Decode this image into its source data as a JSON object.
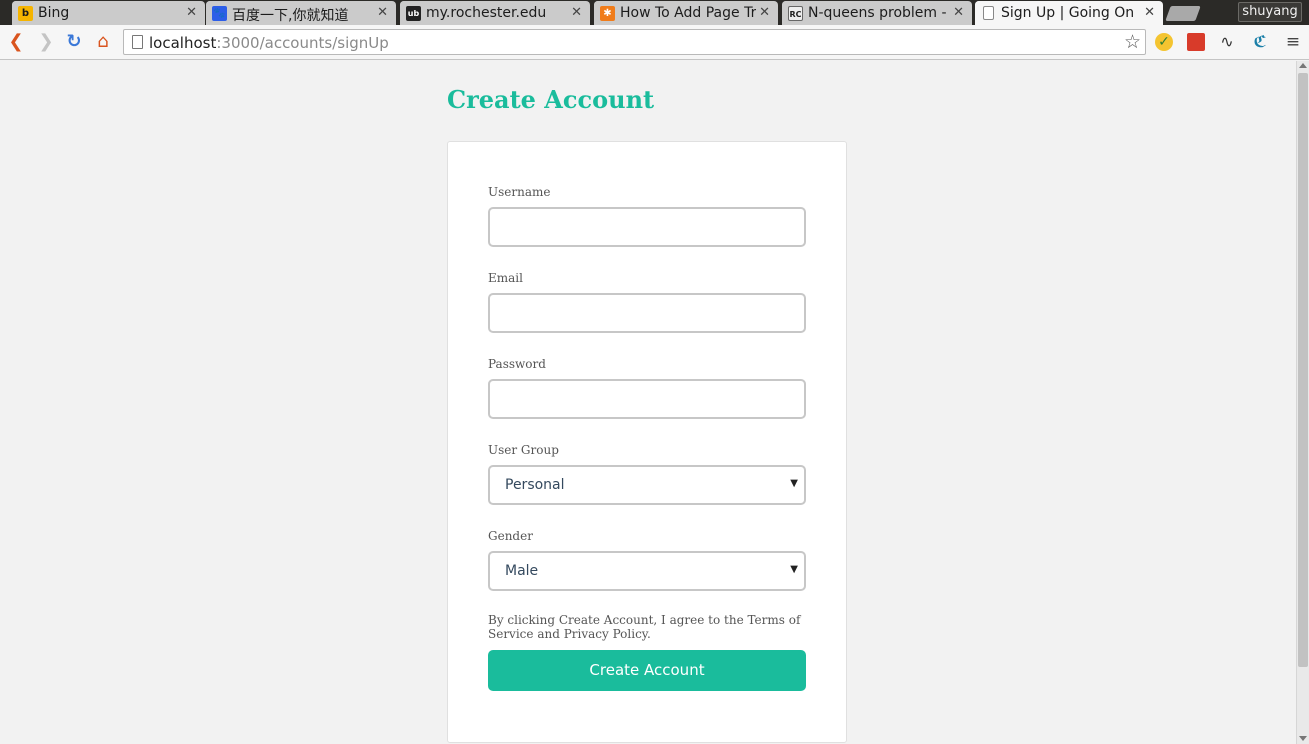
{
  "browser": {
    "tabs": [
      {
        "title": "Bing",
        "favicon": "bing-icon",
        "active": false
      },
      {
        "title": "百度一下,你就知道",
        "favicon": "baidu-paw-icon",
        "active": false
      },
      {
        "title": "my.rochester.edu",
        "favicon": "rochester-icon",
        "active": false
      },
      {
        "title": "How To Add Page Tr",
        "favicon": "asterisk-icon",
        "active": false
      },
      {
        "title": "N-queens problem -",
        "favicon": "rosetta-code-icon",
        "active": false
      },
      {
        "title": "Sign Up | Going On",
        "favicon": "page-icon",
        "active": true
      }
    ],
    "profile_name": "shuyang",
    "url_host": "localhost",
    "url_rest": ":3000/accounts/signUp"
  },
  "page": {
    "title": "Create Account",
    "form": {
      "username_label": "Username",
      "username_value": "",
      "email_label": "Email",
      "email_value": "",
      "password_label": "Password",
      "password_value": "",
      "user_group_label": "User Group",
      "user_group_value": "Personal",
      "gender_label": "Gender",
      "gender_value": "Male",
      "terms_text": "By clicking Create Account, I agree to the Terms of Service and Privacy Policy.",
      "submit_label": "Create Account"
    }
  },
  "colors": {
    "accent": "#1abc9c",
    "page_background": "#f2f2f2",
    "card_background": "#ffffff"
  }
}
